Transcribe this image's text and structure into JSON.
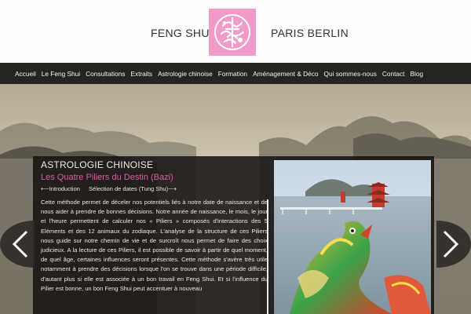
{
  "header": {
    "brand_left": "FENG SHUI",
    "brand_right": "PARIS BERLIN",
    "logo_icon": "chinese-seal-icon",
    "logo_color": "#f39bc8"
  },
  "nav": {
    "items": [
      {
        "label": "Accueil"
      },
      {
        "label": "Le Feng Shui"
      },
      {
        "label": "Consultations"
      },
      {
        "label": "Extraits"
      },
      {
        "label": "Astrologie chinoise"
      },
      {
        "label": "Formation"
      },
      {
        "label": "Aménagement & Déco"
      },
      {
        "label": "Qui sommes-nous"
      },
      {
        "label": "Contact"
      },
      {
        "label": "Blog"
      }
    ]
  },
  "article": {
    "category": "ASTROLOGIE CHINOISE",
    "title": "Les Quatre Piliers du Destin (Bazi)",
    "prev_link": "⟵Introduction",
    "next_link": "Sélection de dates (Tung Shu)⟶",
    "body": "Cette méthode permet de déceler nos potentiels liés à notre date de naissance et de nous aider à prendre de bonnes décisions. Notre année de naissance, le mois, le jour et l'heure permettent de calculer nos « Piliers » composés d'interactions des 5 Eléments et des 12 animaux du zodiaque. L'analyse de la structure de ces Piliers nous guide sur notre chemin de vie et de surcroît nous permet de faire des choix judicieux. A la lecture de ces Piliers, il est possible de savoir à partir de quel moment, de quel âge, certaines influences seront présentes. Cette méthode s'avère très utile notamment à prendre des décisions lorsque l'on se trouve dans une période difficile, d'autant plus si elle est associée à un bon travail en Feng Shui. Et si l'influence du Pilier est bonne, un bon Feng Shui peut accentuer à nouveau"
  },
  "accent_color": "#e25aa3",
  "arrows": {
    "left_icon": "chevron-left-icon",
    "right_icon": "chevron-right-icon"
  }
}
